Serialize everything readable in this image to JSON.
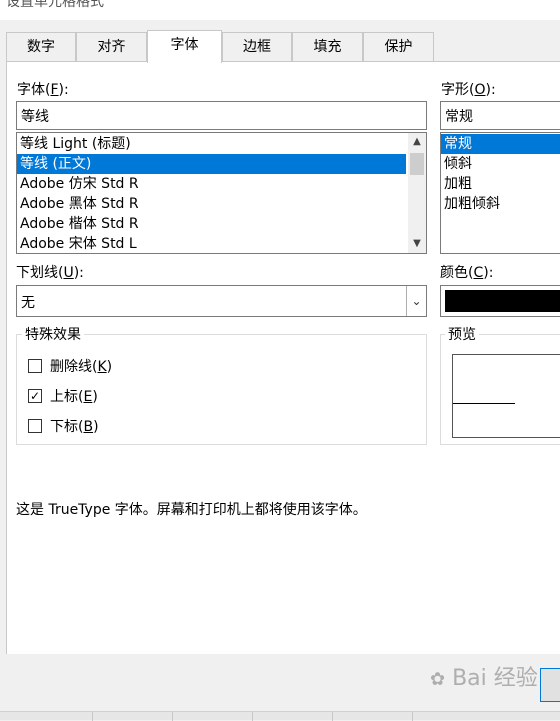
{
  "window": {
    "title": "设置单元格格式"
  },
  "tabs": [
    {
      "label": "数字",
      "active": false
    },
    {
      "label": "对齐",
      "active": false
    },
    {
      "label": "字体",
      "active": true
    },
    {
      "label": "边框",
      "active": false
    },
    {
      "label": "填充",
      "active": false
    },
    {
      "label": "保护",
      "active": false
    }
  ],
  "font": {
    "label_main": "字体(",
    "label_key": "F",
    "label_end": "):",
    "value": "等线",
    "list": [
      {
        "text": "等线 Light (标题)",
        "selected": false
      },
      {
        "text": "等线 (正文)",
        "selected": true
      },
      {
        "text": "Adobe 仿宋 Std R",
        "selected": false
      },
      {
        "text": "Adobe 黑体 Std R",
        "selected": false
      },
      {
        "text": "Adobe 楷体 Std R",
        "selected": false
      },
      {
        "text": "Adobe 宋体 Std L",
        "selected": false
      }
    ]
  },
  "style": {
    "label_main": "字形(",
    "label_key": "O",
    "label_end": "):",
    "value": "常规",
    "list": [
      {
        "text": "常规",
        "selected": true
      },
      {
        "text": "倾斜",
        "selected": false
      },
      {
        "text": "加粗",
        "selected": false
      },
      {
        "text": "加粗倾斜",
        "selected": false
      }
    ]
  },
  "underline": {
    "label_main": "下划线(",
    "label_key": "U",
    "label_end": "):",
    "value": "无"
  },
  "color": {
    "label_main": "颜色(",
    "label_key": "C",
    "label_end": "):",
    "swatch": "#000000"
  },
  "effects": {
    "title": "特殊效果",
    "items": [
      {
        "main": "删除线(",
        "key": "K",
        "end": ")",
        "checked": false
      },
      {
        "main": "上标(",
        "key": "E",
        "end": ")",
        "checked": true
      },
      {
        "main": "下标(",
        "key": "B",
        "end": ")",
        "checked": false
      }
    ]
  },
  "preview": {
    "title": "预览"
  },
  "description": "这是 TrueType 字体。屏幕和打印机上都将使用该字体。",
  "watermark": "Bai 经验",
  "colors": {
    "selection": "#0078d7",
    "panel": "#ffffff",
    "chrome": "#f0f0f0"
  }
}
